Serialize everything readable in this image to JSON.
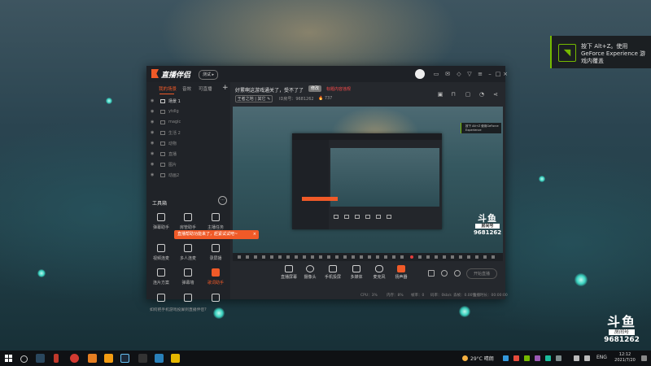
{
  "desktop": {
    "nvidia_notice": "按下 Alt+Z。使用 GeForce Experience 游戏内覆盖",
    "watermark": {
      "brand": "斗鱼",
      "sub": "房间号",
      "room": "9681262"
    }
  },
  "app": {
    "name": "直播伴侣",
    "version_badge": "测试 ▸"
  },
  "left": {
    "tabs": [
      "我的场景",
      "音效",
      "可直播"
    ],
    "add": "+",
    "scenes": [
      "场景 1",
      "ytdlg",
      "magic",
      "生活 2",
      "动物",
      "直播",
      "图片",
      "动画2"
    ],
    "tools_title": "工具箱",
    "tools_more": "···",
    "tools": [
      "弹幕助手",
      "房管助手",
      "主播任务",
      "视频连麦",
      "多人连麦",
      "录屏播",
      "连片方案",
      "弹幕墙",
      "歌词助手",
      "",
      "",
      ""
    ],
    "tooltip": "直播帮助功能来了，赶紧试试吧~",
    "tooltip_close": "×",
    "footer_hint": "如何把手机游戏投屏到直播伴侣?"
  },
  "room": {
    "title": "好累啊这游戏通关了，受不了了",
    "edit": "修改",
    "warn": "标题内容违规",
    "category": "王者之地 | 其它 ✎",
    "id": "ID房号：9681262",
    "heat": "🔥 737"
  },
  "preview": {
    "inner_notice": "按下 Alt+Z 使用GeForce Experience",
    "watermark": {
      "brand": "斗鱼",
      "sub": "房间号",
      "room": "9681262"
    }
  },
  "controls": {
    "buttons": [
      "直播屏幕",
      "摄像头",
      "手机投屏",
      "多媒体",
      "麦克风",
      "扬声器"
    ],
    "start": "开始直播"
  },
  "statusbar": [
    "CPU：3%",
    "内存：8%",
    "帧率：0",
    "码率：0kb/s",
    "丢帧：0.00%",
    "直播时长：00:00:00"
  ],
  "taskbar": {
    "weather": "29°C 晴朗",
    "lang": "ENG",
    "time": "12:12",
    "date": "2021/7/20"
  },
  "colors": {
    "accent": "#f05a28",
    "nvidia": "#76b900",
    "orb": "#3ad3c0"
  }
}
